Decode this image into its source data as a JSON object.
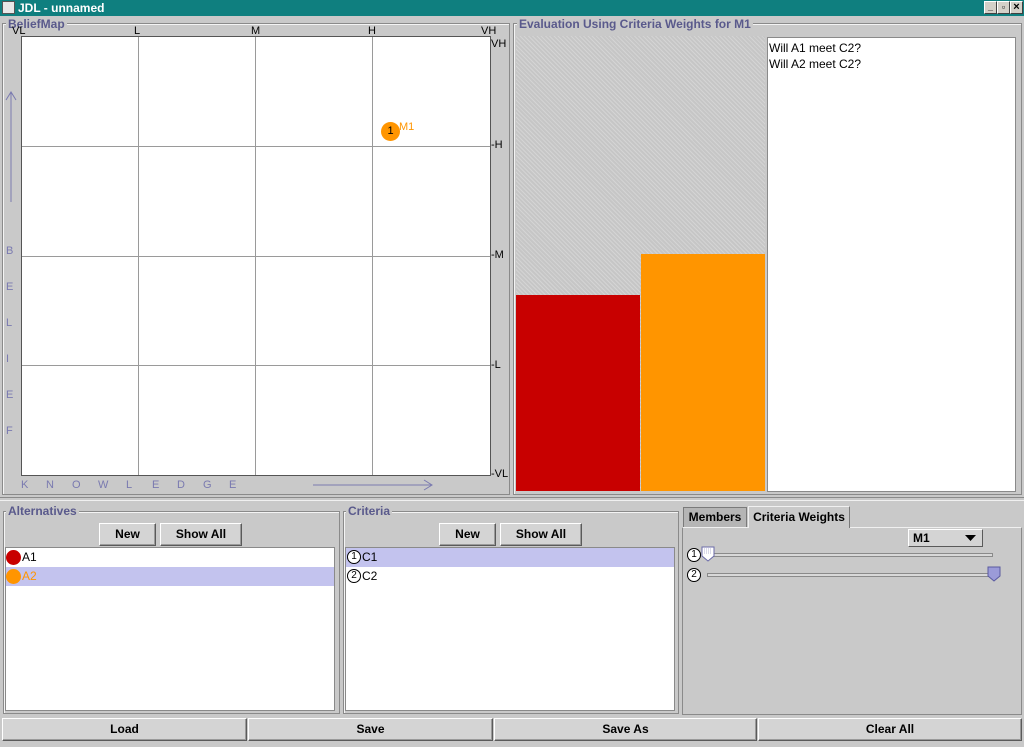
{
  "window": {
    "title": "JDL - unnamed",
    "btn_min": "_",
    "btn_max": "▫",
    "btn_close": "×"
  },
  "belief_map": {
    "title": "BeliefMap",
    "top_ticks": [
      "VL",
      "L",
      "M",
      "H",
      "VH"
    ],
    "right_ticks": [
      "VH",
      "-H",
      "-M",
      "-L",
      "-VL"
    ],
    "y_axis_letters": [
      "B",
      "E",
      "L",
      "I",
      "E",
      "F"
    ],
    "x_axis_letters": [
      "K",
      "N",
      "O",
      "W",
      "L",
      "E",
      "D",
      "G",
      "E"
    ],
    "marker": {
      "number": "1",
      "label": "M1",
      "color": "#ff9500"
    }
  },
  "evaluation": {
    "title": "Evaluation Using Criteria Weights for M1",
    "bars": [
      {
        "color": "#c80000",
        "value": 0.43
      },
      {
        "color": "#ff9500",
        "value": 0.52
      }
    ],
    "questions": [
      "Will A1 meet C2?",
      "Will A2 meet C2?"
    ]
  },
  "alternatives": {
    "title": "Alternatives",
    "new_label": "New",
    "show_all_label": "Show All",
    "items": [
      {
        "label": "A1",
        "color": "#c80000",
        "text_color": "#000000"
      },
      {
        "label": "A2",
        "color": "#ff9500",
        "text_color": "#ff9500"
      }
    ]
  },
  "criteria": {
    "title": "Criteria",
    "new_label": "New",
    "show_all_label": "Show All",
    "items": [
      {
        "num": "1",
        "label": "C1"
      },
      {
        "num": "2",
        "label": "C2"
      }
    ]
  },
  "tabs": {
    "members": "Members",
    "criteria_weights": "Criteria Weights"
  },
  "weights": {
    "selected_member": "M1",
    "sliders": [
      {
        "num": "1",
        "value": 0.0
      },
      {
        "num": "2",
        "value": 1.0
      }
    ]
  },
  "footer": {
    "load": "Load",
    "save": "Save",
    "save_as": "Save As",
    "clear_all": "Clear All"
  }
}
